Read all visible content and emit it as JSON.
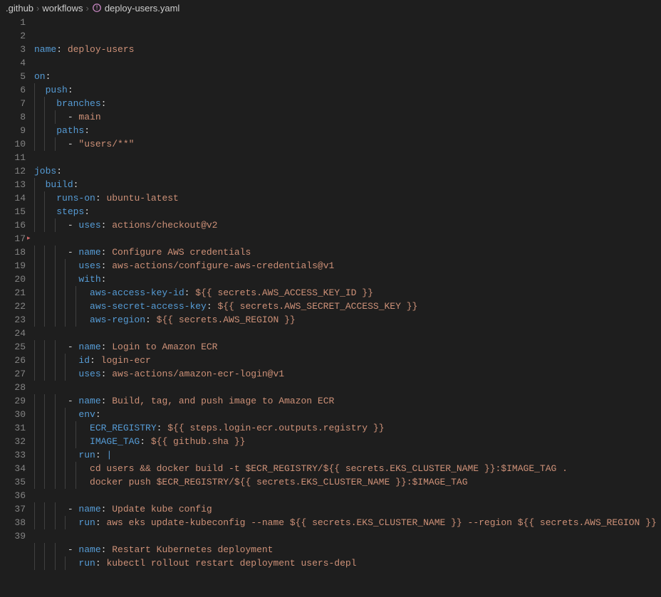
{
  "breadcrumb": {
    "parts": [
      ".github",
      "workflows",
      "deploy-users.yaml"
    ],
    "icon": "yaml"
  },
  "code": {
    "lines": [
      {
        "n": 1,
        "indent": 0,
        "tokens": [
          {
            "t": "name",
            "c": "key"
          },
          {
            "t": ": ",
            "c": "punct"
          },
          {
            "t": "deploy-users",
            "c": "str"
          }
        ]
      },
      {
        "n": 2,
        "indent": 0,
        "tokens": []
      },
      {
        "n": 3,
        "indent": 0,
        "tokens": [
          {
            "t": "on",
            "c": "key"
          },
          {
            "t": ":",
            "c": "punct"
          }
        ]
      },
      {
        "n": 4,
        "indent": 1,
        "tokens": [
          {
            "t": "push",
            "c": "key"
          },
          {
            "t": ":",
            "c": "punct"
          }
        ]
      },
      {
        "n": 5,
        "indent": 2,
        "tokens": [
          {
            "t": "branches",
            "c": "key"
          },
          {
            "t": ":",
            "c": "punct"
          }
        ]
      },
      {
        "n": 6,
        "indent": 3,
        "tokens": [
          {
            "t": "- ",
            "c": "punct"
          },
          {
            "t": "main",
            "c": "str"
          }
        ]
      },
      {
        "n": 7,
        "indent": 2,
        "tokens": [
          {
            "t": "paths",
            "c": "key"
          },
          {
            "t": ":",
            "c": "punct"
          }
        ]
      },
      {
        "n": 8,
        "indent": 3,
        "tokens": [
          {
            "t": "- ",
            "c": "punct"
          },
          {
            "t": "\"users/**\"",
            "c": "str"
          }
        ]
      },
      {
        "n": 9,
        "indent": 0,
        "tokens": []
      },
      {
        "n": 10,
        "indent": 0,
        "tokens": [
          {
            "t": "jobs",
            "c": "key"
          },
          {
            "t": ":",
            "c": "punct"
          }
        ]
      },
      {
        "n": 11,
        "indent": 1,
        "tokens": [
          {
            "t": "build",
            "c": "key"
          },
          {
            "t": ":",
            "c": "punct"
          }
        ]
      },
      {
        "n": 12,
        "indent": 2,
        "tokens": [
          {
            "t": "runs-on",
            "c": "key"
          },
          {
            "t": ": ",
            "c": "punct"
          },
          {
            "t": "ubuntu-latest",
            "c": "str"
          }
        ]
      },
      {
        "n": 13,
        "indent": 2,
        "tokens": [
          {
            "t": "steps",
            "c": "key"
          },
          {
            "t": ":",
            "c": "punct"
          }
        ]
      },
      {
        "n": 14,
        "indent": 3,
        "tokens": [
          {
            "t": "- ",
            "c": "punct"
          },
          {
            "t": "uses",
            "c": "key"
          },
          {
            "t": ": ",
            "c": "punct"
          },
          {
            "t": "actions/checkout@v2",
            "c": "str"
          }
        ]
      },
      {
        "n": 15,
        "indent": 0,
        "tokens": [],
        "marker": true
      },
      {
        "n": 16,
        "indent": 3,
        "tokens": [
          {
            "t": "- ",
            "c": "punct"
          },
          {
            "t": "name",
            "c": "key"
          },
          {
            "t": ": ",
            "c": "punct"
          },
          {
            "t": "Configure AWS credentials",
            "c": "str"
          }
        ]
      },
      {
        "n": 17,
        "indent": 4,
        "tokens": [
          {
            "t": "uses",
            "c": "key"
          },
          {
            "t": ": ",
            "c": "punct"
          },
          {
            "t": "aws-actions/configure-aws-credentials@v1",
            "c": "str"
          }
        ]
      },
      {
        "n": 18,
        "indent": 4,
        "tokens": [
          {
            "t": "with",
            "c": "key"
          },
          {
            "t": ":",
            "c": "punct"
          }
        ]
      },
      {
        "n": 19,
        "indent": 5,
        "tokens": [
          {
            "t": "aws-access-key-id",
            "c": "key"
          },
          {
            "t": ": ",
            "c": "punct"
          },
          {
            "t": "${{ secrets.AWS_ACCESS_KEY_ID }}",
            "c": "str"
          }
        ]
      },
      {
        "n": 20,
        "indent": 5,
        "tokens": [
          {
            "t": "aws-secret-access-key",
            "c": "key"
          },
          {
            "t": ": ",
            "c": "punct"
          },
          {
            "t": "${{ secrets.AWS_SECRET_ACCESS_KEY }}",
            "c": "str"
          }
        ]
      },
      {
        "n": 21,
        "indent": 5,
        "tokens": [
          {
            "t": "aws-region",
            "c": "key"
          },
          {
            "t": ": ",
            "c": "punct"
          },
          {
            "t": "${{ secrets.AWS_REGION }}",
            "c": "str"
          }
        ]
      },
      {
        "n": 22,
        "indent": 0,
        "tokens": []
      },
      {
        "n": 23,
        "indent": 3,
        "tokens": [
          {
            "t": "- ",
            "c": "punct"
          },
          {
            "t": "name",
            "c": "key"
          },
          {
            "t": ": ",
            "c": "punct"
          },
          {
            "t": "Login to Amazon ECR",
            "c": "str"
          }
        ]
      },
      {
        "n": 24,
        "indent": 4,
        "tokens": [
          {
            "t": "id",
            "c": "key"
          },
          {
            "t": ": ",
            "c": "punct"
          },
          {
            "t": "login-ecr",
            "c": "str"
          }
        ]
      },
      {
        "n": 25,
        "indent": 4,
        "tokens": [
          {
            "t": "uses",
            "c": "key"
          },
          {
            "t": ": ",
            "c": "punct"
          },
          {
            "t": "aws-actions/amazon-ecr-login@v1",
            "c": "str"
          }
        ]
      },
      {
        "n": 26,
        "indent": 0,
        "tokens": []
      },
      {
        "n": 27,
        "indent": 3,
        "tokens": [
          {
            "t": "- ",
            "c": "punct"
          },
          {
            "t": "name",
            "c": "key"
          },
          {
            "t": ": ",
            "c": "punct"
          },
          {
            "t": "Build, tag, and push image to Amazon ECR",
            "c": "str"
          }
        ]
      },
      {
        "n": 28,
        "indent": 4,
        "tokens": [
          {
            "t": "env",
            "c": "key"
          },
          {
            "t": ":",
            "c": "punct"
          }
        ]
      },
      {
        "n": 29,
        "indent": 5,
        "tokens": [
          {
            "t": "ECR_REGISTRY",
            "c": "key"
          },
          {
            "t": ": ",
            "c": "punct"
          },
          {
            "t": "${{ steps.login-ecr.outputs.registry }}",
            "c": "str"
          }
        ]
      },
      {
        "n": 30,
        "indent": 5,
        "tokens": [
          {
            "t": "IMAGE_TAG",
            "c": "key"
          },
          {
            "t": ": ",
            "c": "punct"
          },
          {
            "t": "${{ github.sha }}",
            "c": "str"
          }
        ]
      },
      {
        "n": 31,
        "indent": 4,
        "tokens": [
          {
            "t": "run",
            "c": "key"
          },
          {
            "t": ": ",
            "c": "punct"
          },
          {
            "t": "|",
            "c": "key"
          }
        ]
      },
      {
        "n": 32,
        "indent": 5,
        "tokens": [
          {
            "t": "cd users && docker build -t $ECR_REGISTRY/${{ secrets.EKS_CLUSTER_NAME }}:$IMAGE_TAG .",
            "c": "str"
          }
        ]
      },
      {
        "n": 33,
        "indent": 5,
        "tokens": [
          {
            "t": "docker push $ECR_REGISTRY/${{ secrets.EKS_CLUSTER_NAME }}:$IMAGE_TAG",
            "c": "str"
          }
        ]
      },
      {
        "n": 34,
        "indent": 0,
        "tokens": []
      },
      {
        "n": 35,
        "indent": 3,
        "tokens": [
          {
            "t": "- ",
            "c": "punct"
          },
          {
            "t": "name",
            "c": "key"
          },
          {
            "t": ": ",
            "c": "punct"
          },
          {
            "t": "Update kube config",
            "c": "str"
          }
        ]
      },
      {
        "n": 36,
        "indent": 4,
        "tokens": [
          {
            "t": "run",
            "c": "key"
          },
          {
            "t": ": ",
            "c": "punct"
          },
          {
            "t": "aws eks update-kubeconfig --name ${{ secrets.EKS_CLUSTER_NAME }} --region ${{ secrets.AWS_REGION }}",
            "c": "str"
          }
        ]
      },
      {
        "n": 37,
        "indent": 0,
        "tokens": []
      },
      {
        "n": 38,
        "indent": 3,
        "tokens": [
          {
            "t": "- ",
            "c": "punct"
          },
          {
            "t": "name",
            "c": "key"
          },
          {
            "t": ": ",
            "c": "punct"
          },
          {
            "t": "Restart Kubernetes deployment",
            "c": "str"
          }
        ]
      },
      {
        "n": 39,
        "indent": 4,
        "tokens": [
          {
            "t": "run",
            "c": "key"
          },
          {
            "t": ": ",
            "c": "punct"
          },
          {
            "t": "kubectl rollout restart deployment users-depl",
            "c": "str"
          }
        ]
      }
    ]
  }
}
